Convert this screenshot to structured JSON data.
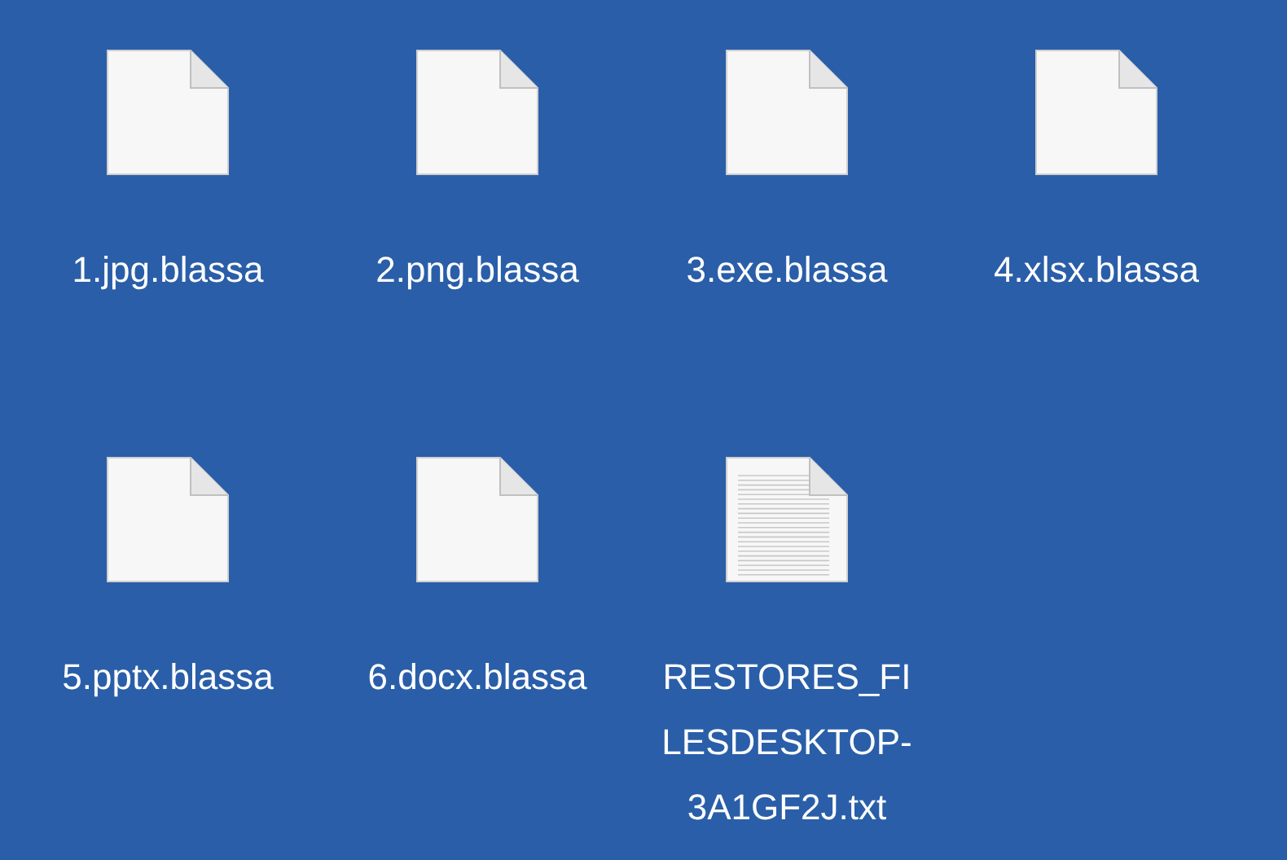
{
  "files": [
    {
      "name": "1.jpg.blassa",
      "kind": "blank"
    },
    {
      "name": "2.png.blassa",
      "kind": "blank"
    },
    {
      "name": "3.exe.blassa",
      "kind": "blank"
    },
    {
      "name": "4.xlsx.blassa",
      "kind": "blank"
    },
    {
      "name": "5.pptx.blassa",
      "kind": "blank"
    },
    {
      "name": "6.docx.blassa",
      "kind": "blank"
    },
    {
      "name": "RESTORES_FILESDESKTOP-3A1GF2J.txt",
      "kind": "text"
    }
  ]
}
